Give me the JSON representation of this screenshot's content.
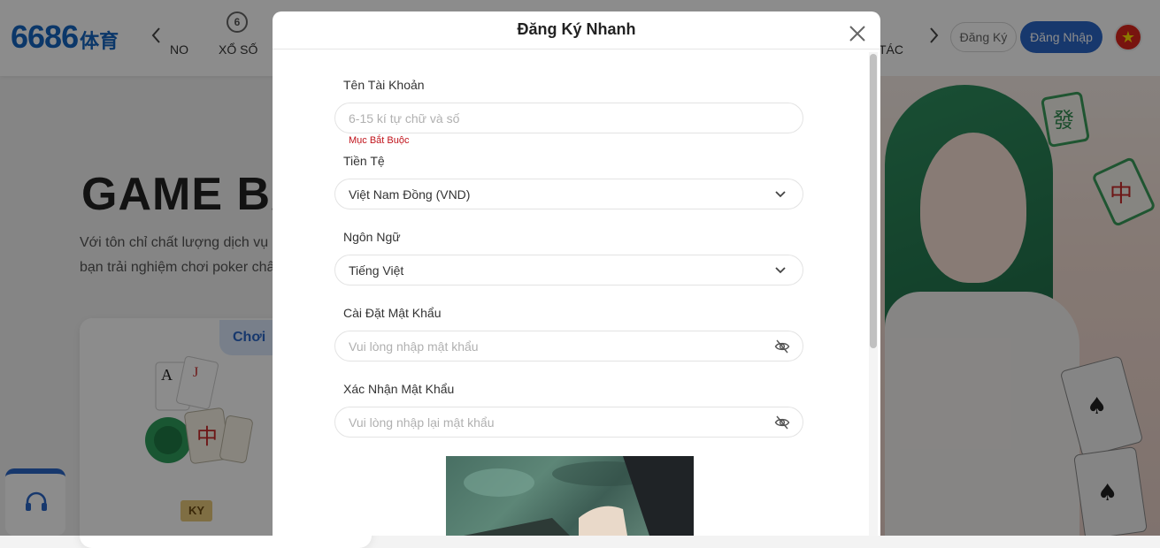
{
  "header": {
    "logo_text": "6686",
    "logo_sub": "体育",
    "nav_prev": "‹",
    "nav_next": "›",
    "nav_items": [
      "NO",
      "XỔ SỐ",
      "TÁC"
    ],
    "lotto_icon_glyph": "6",
    "register_label": "Đăng Ký",
    "login_label": "Đăng Nhập",
    "flag_glyph": "★"
  },
  "page": {
    "title": "GAME BÀ",
    "desc_line1": "Với tôn chỉ chất lượng dịch vụ",
    "desc_line2": "bạn trải nghiệm chơi poker chấ",
    "card_tag": "Chơi",
    "card_badge": "KY"
  },
  "modal": {
    "title": "Đăng Ký Nhanh",
    "fields": {
      "username": {
        "label": "Tên Tài Khoản",
        "placeholder": "6-15 kí tự chữ và số",
        "error": "Mục Bắt Buộc"
      },
      "currency": {
        "label": "Tiền Tệ",
        "value": "Việt Nam Đồng (VND)"
      },
      "language": {
        "label": "Ngôn Ngữ",
        "value": "Tiếng Việt"
      },
      "password": {
        "label": "Cài Đặt Mật Khẩu",
        "placeholder": "Vui lòng nhập mật khẩu"
      },
      "confirm_password": {
        "label": "Xác Nhận Mật Khẩu",
        "placeholder": "Vui lòng nhập lại mật khẩu"
      }
    }
  },
  "colors": {
    "brand": "#2a66c6",
    "error": "#c0121a",
    "flag": "#da251d"
  },
  "icons": [
    "close-icon",
    "chevron-down-icon",
    "eye-off-icon",
    "headset-icon",
    "chevron-left-icon",
    "chevron-right-icon"
  ]
}
